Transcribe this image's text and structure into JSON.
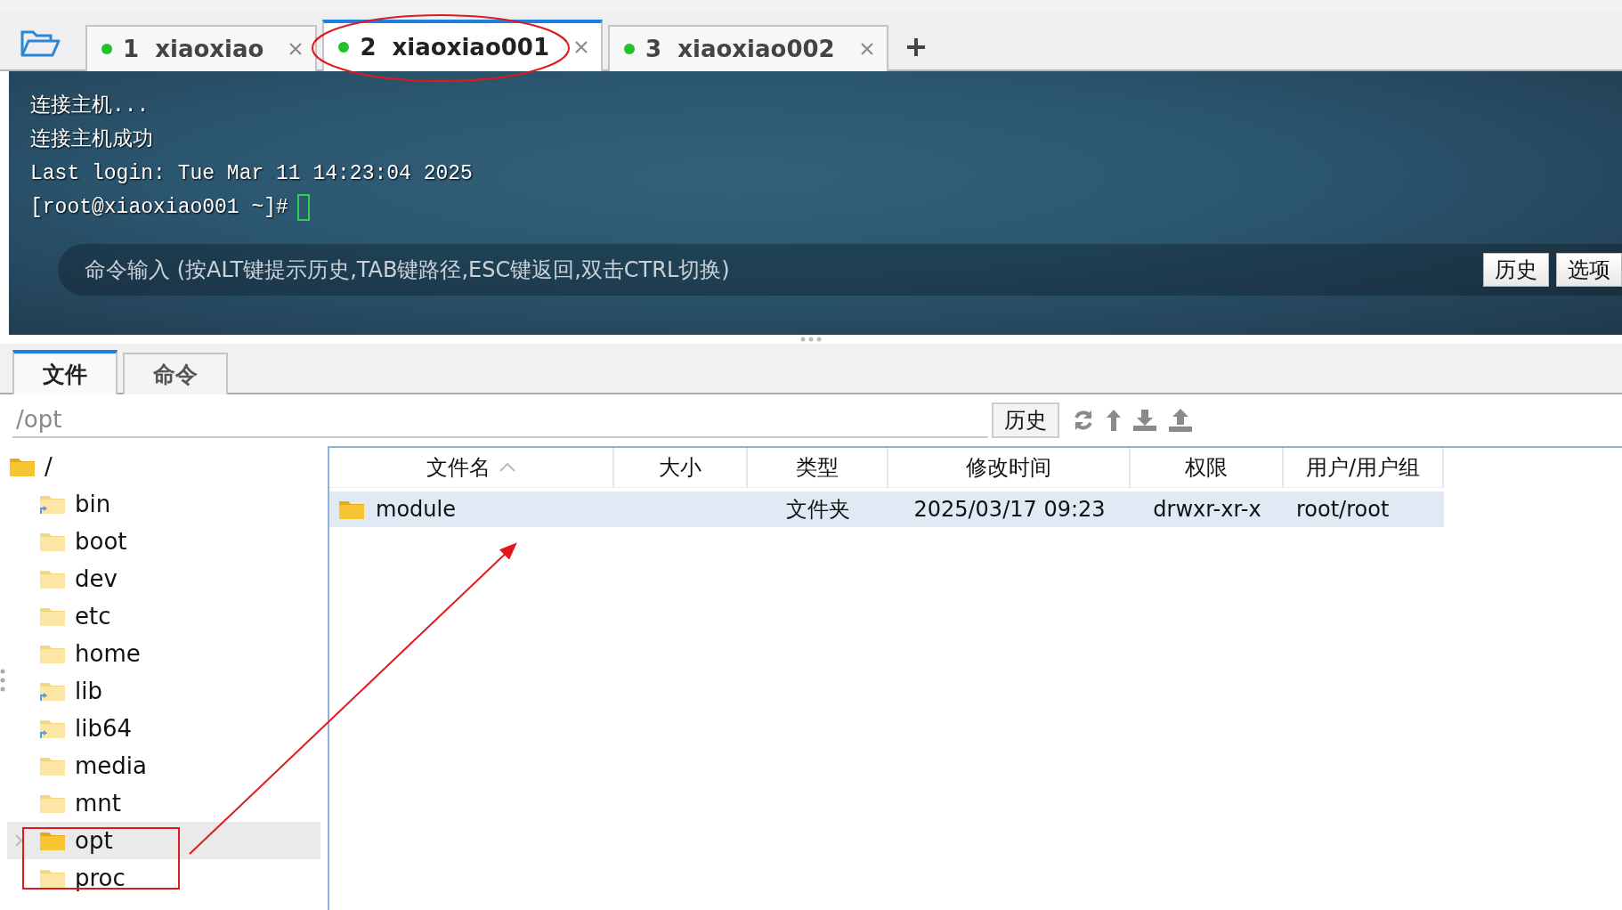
{
  "session_tabs": [
    {
      "number": "1",
      "label": "xiaoxiao",
      "connected": true,
      "selected": false
    },
    {
      "number": "2",
      "label": "xiaoxiao001",
      "connected": true,
      "selected": true
    },
    {
      "number": "3",
      "label": "xiaoxiao002",
      "connected": true,
      "selected": false
    }
  ],
  "terminal": {
    "lines": [
      "连接主机...",
      "连接主机成功",
      "Last login: Tue Mar 11 14:23:04 2025"
    ],
    "prompt": "[root@xiaoxiao001 ~]#",
    "command_input": {
      "placeholder": "命令输入 (按ALT键提示历史,TAB键路径,ESC键返回,双击CTRL切换)"
    },
    "buttons": [
      "历史",
      "选项"
    ]
  },
  "panel_tabs": [
    {
      "label": "文件",
      "selected": true
    },
    {
      "label": "命令",
      "selected": false
    }
  ],
  "path_field": {
    "value": "/opt"
  },
  "history_button": "历史",
  "tree": {
    "label": "/",
    "children": [
      {
        "label": "bin",
        "kind": "link",
        "selected": false
      },
      {
        "label": "boot",
        "kind": "folder",
        "selected": false
      },
      {
        "label": "dev",
        "kind": "folder",
        "selected": false
      },
      {
        "label": "etc",
        "kind": "folder",
        "selected": false
      },
      {
        "label": "home",
        "kind": "folder",
        "selected": false
      },
      {
        "label": "lib",
        "kind": "link",
        "selected": false
      },
      {
        "label": "lib64",
        "kind": "link",
        "selected": false
      },
      {
        "label": "media",
        "kind": "folder",
        "selected": false
      },
      {
        "label": "mnt",
        "kind": "folder",
        "selected": false
      },
      {
        "label": "opt",
        "kind": "folder",
        "selected": true
      },
      {
        "label": "proc",
        "kind": "folder",
        "selected": false
      }
    ]
  },
  "table": {
    "columns": [
      {
        "label": "文件名",
        "sorted": true
      },
      {
        "label": "大小",
        "sorted": false
      },
      {
        "label": "类型",
        "sorted": false
      },
      {
        "label": "修改时间",
        "sorted": false
      },
      {
        "label": "权限",
        "sorted": false
      },
      {
        "label": "用户/用户组",
        "sorted": false
      }
    ],
    "rows": [
      {
        "name": "module",
        "type": "文件夹",
        "modified": "2025/03/17 09:23",
        "permissions": "drwxr-xr-x",
        "owner": "root/root",
        "selected": true
      }
    ]
  }
}
